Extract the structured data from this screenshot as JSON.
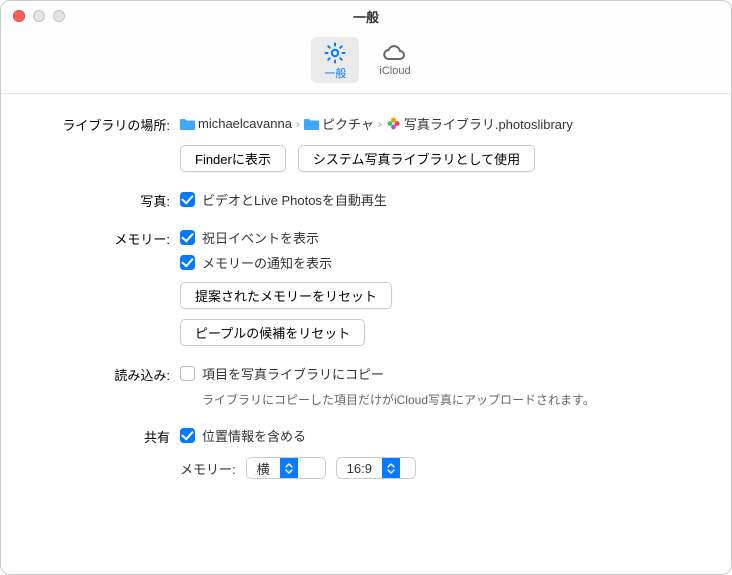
{
  "window": {
    "title": "一般"
  },
  "tabs": {
    "general": "一般",
    "icloud": "iCloud"
  },
  "library": {
    "label": "ライブラリの場所:",
    "path": {
      "user": "michaelcavanna",
      "pictures": "ピクチャ",
      "library": "写真ライブラリ.photoslibrary"
    },
    "show_in_finder": "Finderに表示",
    "use_as_system": "システム写真ライブラリとして使用"
  },
  "photos": {
    "label": "写真:",
    "autoplay": "ビデオとLive Photosを自動再生"
  },
  "memories": {
    "label": "メモリー:",
    "show_holidays": "祝日イベントを表示",
    "show_notifications": "メモリーの通知を表示",
    "reset_suggested": "提案されたメモリーをリセット",
    "reset_people": "ピープルの候補をリセット"
  },
  "import": {
    "label": "読み込み:",
    "copy_items": "項目を写真ライブラリにコピー",
    "note": "ライブラリにコピーした項目だけがiCloud写真にアップロードされます。"
  },
  "sharing": {
    "label": "共有",
    "include_location": "位置情報を含める",
    "memories_label": "メモリー:",
    "orientation": "横",
    "aspect": "16:9"
  }
}
